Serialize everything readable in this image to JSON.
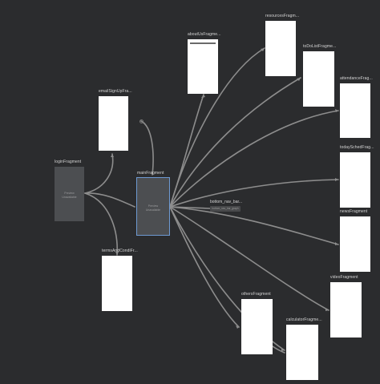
{
  "graph": {
    "fragments": {
      "login": {
        "title": "loginFragment",
        "preview_line1": "Preview",
        "preview_line2": "Unavailable"
      },
      "emailSignUp": {
        "title": "emailSignUpFra..."
      },
      "termsAndCond": {
        "title": "termsAndCondiFr..."
      },
      "main": {
        "title": "mainFragment",
        "preview_line1": "Preview",
        "preview_line2": "Unavailable"
      },
      "about": {
        "title": "aboutUsFragme..."
      },
      "resources": {
        "title": "resourcesFragm..."
      },
      "todo": {
        "title": "toDoListFragme..."
      },
      "attendance": {
        "title": "attendanceFrag..."
      },
      "todaySchedule": {
        "title": "todaySchedFrag..."
      },
      "news": {
        "title": "newsFragment"
      },
      "video": {
        "title": "videoFragment"
      },
      "other": {
        "title": "othersFragment"
      },
      "calculator": {
        "title": "calculatorFragme..."
      }
    },
    "action": {
      "label": "bottom_nav_bar...",
      "chip_text": "bottom_nav_bar_graph"
    }
  }
}
